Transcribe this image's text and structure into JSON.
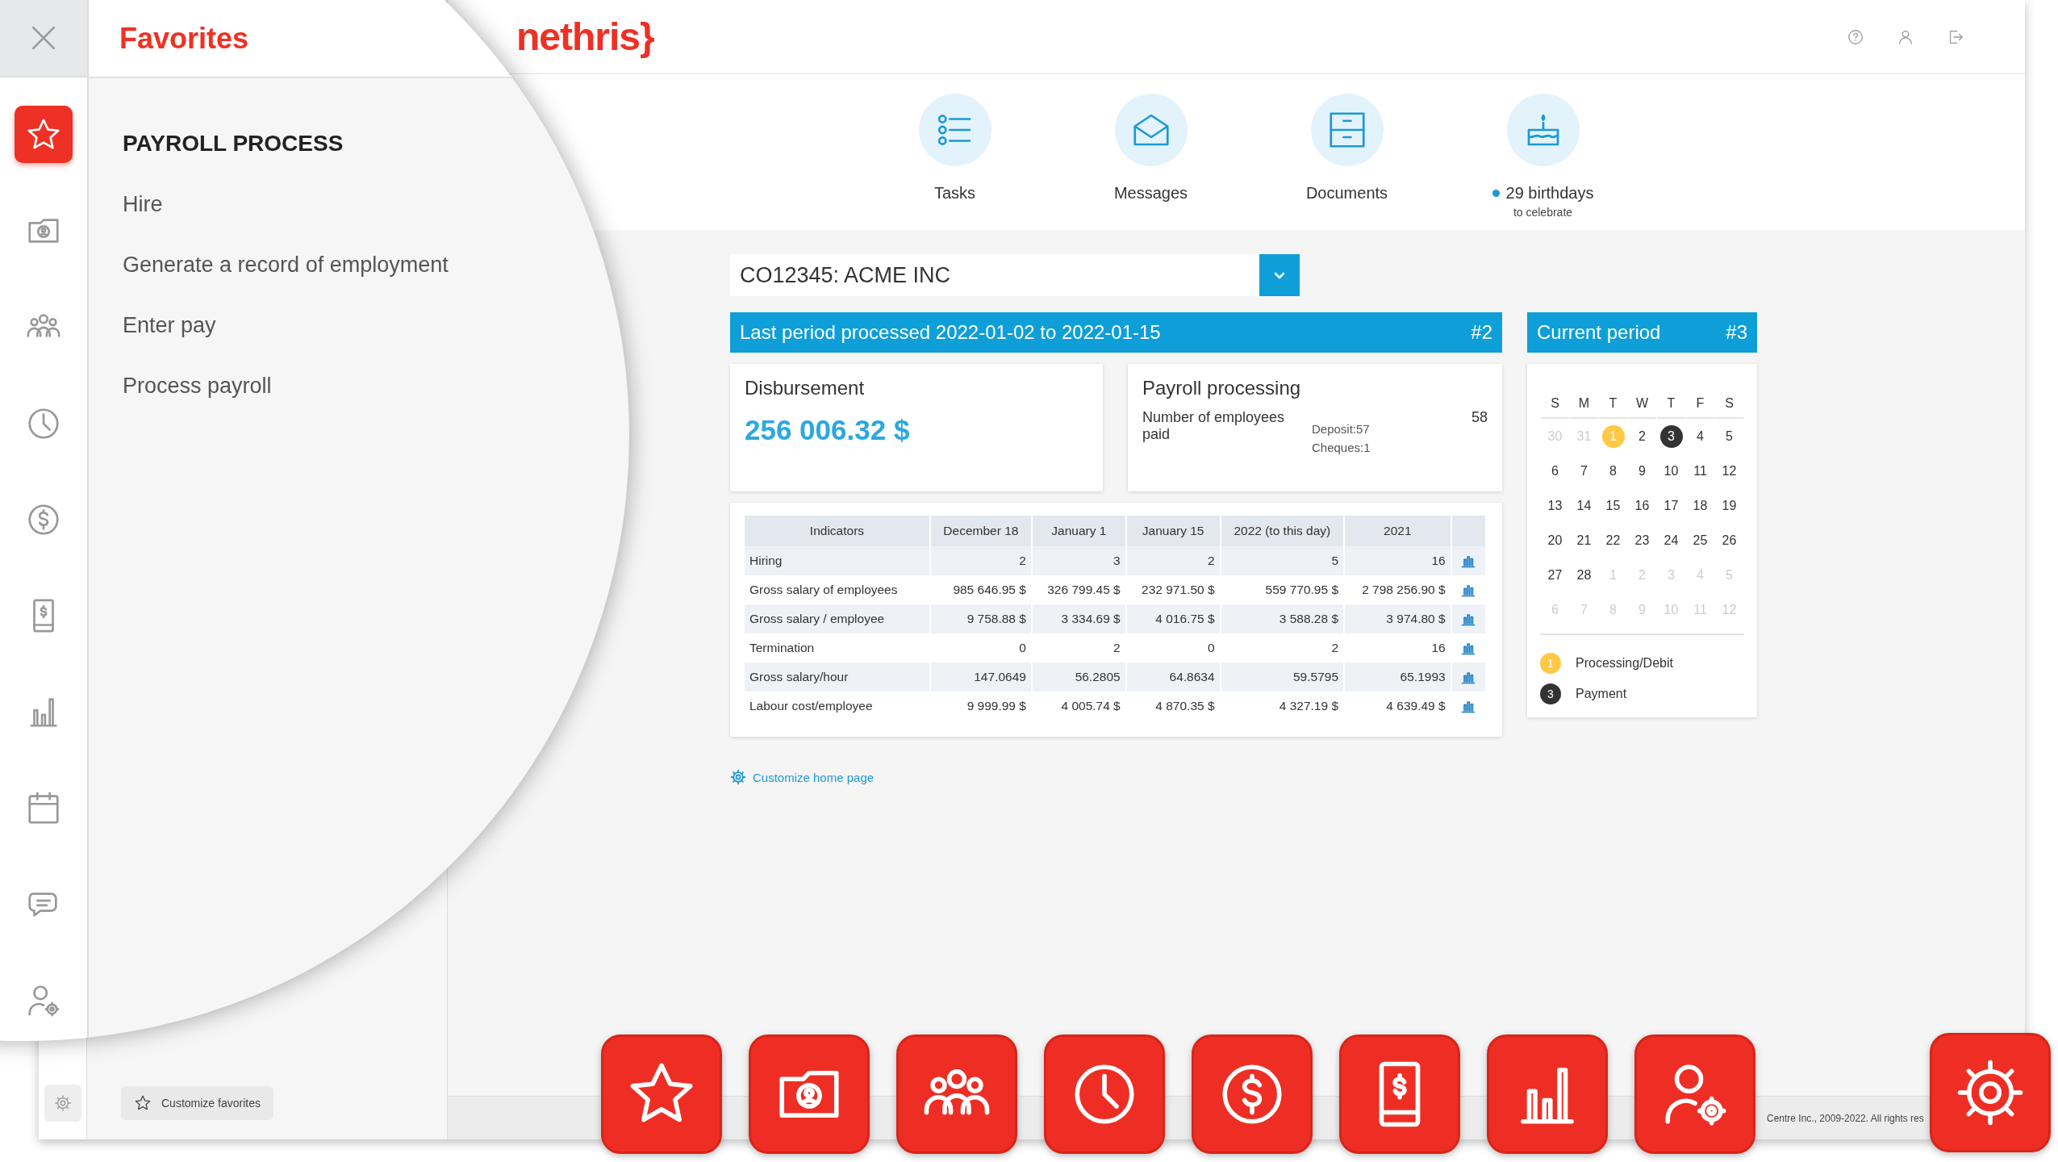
{
  "app": {
    "logo": "nethris}",
    "quick_links": [
      {
        "label": "Tasks",
        "dot": false
      },
      {
        "label": "Messages",
        "dot": false
      },
      {
        "label": "Documents",
        "dot": false
      },
      {
        "label": "29 birthdays",
        "sublabel": "to celebrate",
        "dot": true
      }
    ],
    "company_select": {
      "value": "CO12345: ACME INC"
    },
    "last_period": {
      "title": "Last period processed 2022-01-02 to 2022-01-15",
      "number": "#2"
    },
    "disbursement": {
      "title": "Disbursement",
      "amount": "256 006.32 $"
    },
    "payroll_processing": {
      "title": "Payroll processing",
      "label": "Number of employees paid",
      "count": "58",
      "details": [
        "Deposit:57",
        "Cheques:1"
      ]
    },
    "indicators": {
      "columns": [
        "Indicators",
        "December 18",
        "January 1",
        "January 15",
        "2022 (to this day)",
        "2021"
      ],
      "rows": [
        [
          "Hiring",
          "2",
          "3",
          "2",
          "5",
          "16"
        ],
        [
          "Gross salary of employees",
          "985 646.95 $",
          "326 799.45 $",
          "232 971.50 $",
          "559 770.95 $",
          "2 798 256.90 $"
        ],
        [
          "Gross salary / employee",
          "9 758.88 $",
          "3 334.69 $",
          "4 016.75 $",
          "3 588.28 $",
          "3 974.80 $"
        ],
        [
          "Termination",
          "0",
          "2",
          "0",
          "2",
          "16"
        ],
        [
          "Gross salary/hour",
          "147.0649",
          "56.2805",
          "64.8634",
          "59.5795",
          "65.1993"
        ],
        [
          "Labour cost/employee",
          "9 999.99 $",
          "4 005.74 $",
          "4 870.35 $",
          "4 327.19 $",
          "4 639.49 $"
        ]
      ]
    },
    "current_period": {
      "title": "Current period",
      "number": "#3",
      "weekdays": [
        "S",
        "M",
        "T",
        "W",
        "T",
        "F",
        "S"
      ],
      "weeks": [
        [
          {
            "day": "30",
            "muted": true
          },
          {
            "day": "31",
            "muted": true
          },
          {
            "day": "1",
            "muted": false,
            "color": "#ffc845"
          },
          {
            "day": "2",
            "muted": false
          },
          {
            "day": "3",
            "muted": false,
            "color": "#333333"
          },
          {
            "day": "4",
            "muted": false
          },
          {
            "day": "5",
            "muted": false
          }
        ],
        [
          {
            "day": "6",
            "muted": false
          },
          {
            "day": "7",
            "muted": false
          },
          {
            "day": "8",
            "muted": false
          },
          {
            "day": "9",
            "muted": false
          },
          {
            "day": "10",
            "muted": false
          },
          {
            "day": "11",
            "muted": false
          },
          {
            "day": "12",
            "muted": false
          }
        ],
        [
          {
            "day": "13",
            "muted": false
          },
          {
            "day": "14",
            "muted": false
          },
          {
            "day": "15",
            "muted": false
          },
          {
            "day": "16",
            "muted": false
          },
          {
            "day": "17",
            "muted": false
          },
          {
            "day": "18",
            "muted": false
          },
          {
            "day": "19",
            "muted": false
          }
        ],
        [
          {
            "day": "20",
            "muted": false
          },
          {
            "day": "21",
            "muted": false
          },
          {
            "day": "22",
            "muted": false
          },
          {
            "day": "23",
            "muted": false
          },
          {
            "day": "24",
            "muted": false
          },
          {
            "day": "25",
            "muted": false
          },
          {
            "day": "26",
            "muted": false
          }
        ],
        [
          {
            "day": "27",
            "muted": false
          },
          {
            "day": "28",
            "muted": false
          },
          {
            "day": "1",
            "muted": true
          },
          {
            "day": "2",
            "muted": true
          },
          {
            "day": "3",
            "muted": true
          },
          {
            "day": "4",
            "muted": true
          },
          {
            "day": "5",
            "muted": true
          }
        ],
        [
          {
            "day": "6",
            "muted": true
          },
          {
            "day": "7",
            "muted": true
          },
          {
            "day": "8",
            "muted": true
          },
          {
            "day": "9",
            "muted": true
          },
          {
            "day": "10",
            "muted": true
          },
          {
            "day": "11",
            "muted": true
          },
          {
            "day": "12",
            "muted": true
          }
        ]
      ],
      "legend": [
        {
          "badge": "1",
          "label": "Processing/Debit",
          "color": "#ffc845"
        },
        {
          "badge": "3",
          "label": "Payment",
          "color": "#333333"
        }
      ]
    },
    "customize_link": "Customize home page",
    "customize_favorites": "Customize favorites",
    "footer": "Centre Inc., 2009-2022. All rights res"
  },
  "favorites_overlay": {
    "title": "Favorites",
    "sidebar": [
      {
        "selected": true
      },
      {
        "selected": false
      },
      {
        "selected": false
      },
      {
        "selected": false
      },
      {
        "selected": false
      },
      {
        "selected": false
      },
      {
        "selected": false
      },
      {
        "selected": false
      },
      {
        "selected": false
      },
      {
        "selected": false
      }
    ],
    "section": "PAYROLL PROCESS",
    "items": [
      "Hire",
      "Generate a record of employment",
      "Enter pay",
      "Process payroll"
    ]
  }
}
